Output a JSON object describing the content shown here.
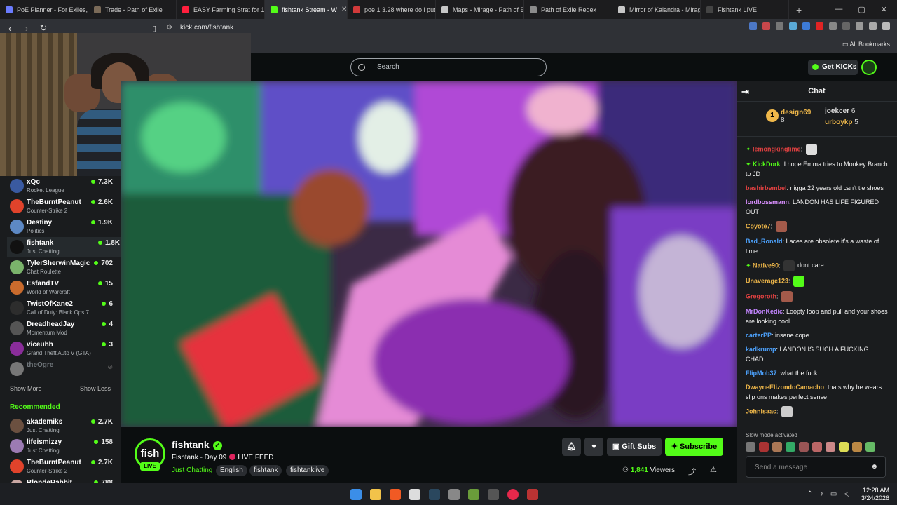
{
  "browser": {
    "tabs": [
      {
        "title": "PoE Planner - For Exiles, By",
        "color": "#6b7cff"
      },
      {
        "title": "Trade - Path of Exile",
        "color": "#7a6a58"
      },
      {
        "title": "EASY Farming Strat for 15-",
        "color": "#ff1f3d"
      },
      {
        "title": "fishtank Stream - W",
        "color": "#53fc18",
        "active": true
      },
      {
        "title": "poe 1 3.28 where do i put",
        "color": "#d23a3a"
      },
      {
        "title": "Maps - Mirage - Path of E",
        "color": "#c7c7c7"
      },
      {
        "title": "Path of Exile Regex",
        "color": "#8b8b8b"
      },
      {
        "title": "Mirror of Kalandra - Mirag",
        "color": "#c7c7c7"
      },
      {
        "title": "Fishtank LIVE",
        "color": "#444"
      }
    ],
    "url": "kick.com/fishtank",
    "all_bookmarks": "All Bookmarks"
  },
  "header": {
    "search_placeholder": "Search",
    "get_kicks": "Get KICKs"
  },
  "sidebar": {
    "following": [
      {
        "name": "xQc",
        "category": "Rocket League",
        "viewers": "7.3K",
        "color": "#3a5aa0"
      },
      {
        "name": "TheBurntPeanut",
        "category": "Counter-Strike 2",
        "viewers": "2.6K",
        "color": "#e0432b"
      },
      {
        "name": "Destiny",
        "category": "Politics",
        "viewers": "1.9K",
        "color": "#5d89c4"
      },
      {
        "name": "fishtank",
        "category": "Just Chatting",
        "viewers": "1.8K",
        "color": "#111",
        "selected": true
      },
      {
        "name": "TylerSherwinMagic",
        "category": "Chat Roulette",
        "viewers": "702",
        "color": "#7ab36b"
      },
      {
        "name": "EsfandTV",
        "category": "World of Warcraft",
        "viewers": "15",
        "color": "#c96b2d"
      },
      {
        "name": "TwistOfKane2",
        "category": "Call of Duty: Black Ops 7",
        "viewers": "6",
        "color": "#2d2d2d"
      },
      {
        "name": "DreadheadJay",
        "category": "Momentum Mod",
        "viewers": "4",
        "color": "#555"
      },
      {
        "name": "viceuhh",
        "category": "Grand Theft Auto V (GTA)",
        "viewers": "3",
        "color": "#8a2d9a"
      },
      {
        "name": "theOgre",
        "category": "",
        "viewers": "",
        "color": "#777",
        "offline": true
      }
    ],
    "show_more": "Show More",
    "show_less": "Show Less",
    "recommended_label": "Recommended",
    "recommended": [
      {
        "name": "akademiks",
        "category": "Just Chatting",
        "viewers": "2.7K",
        "color": "#6b5040"
      },
      {
        "name": "lifeismizzy",
        "category": "Just Chatting",
        "viewers": "158",
        "color": "#9c7bb3"
      },
      {
        "name": "TheBurntPeanut",
        "category": "Counter-Strike 2",
        "viewers": "2.7K",
        "color": "#e0432b"
      },
      {
        "name": "BlondeRabbit",
        "category": "",
        "viewers": "788",
        "color": "#c9a7a2"
      }
    ]
  },
  "stream": {
    "channel": "fishtank",
    "logo_text": "fish",
    "live_badge": "LIVE",
    "title": "Fishtank - Day 09",
    "live_feed": "LIVE FEED",
    "category": "Just Chatting",
    "tags": [
      "English",
      "fishtank",
      "fishtanklive"
    ],
    "gift_subs": "Gift Subs",
    "subscribe": "Subscribe",
    "viewers_count": "1,841",
    "viewers_label": "Viewers"
  },
  "chat": {
    "title": "Chat",
    "leaderboard": [
      {
        "rank": "1",
        "name": "design69",
        "count": "8"
      },
      {
        "name": "joekcer",
        "count": "6"
      },
      {
        "name": "urboykp",
        "count": "5"
      }
    ],
    "messages": [
      {
        "user": "lemongkinglime",
        "text": "",
        "color": "#e34141",
        "emote": "#ddd",
        "badge": true
      },
      {
        "user": "KickDork",
        "text": "I hope Emma tries to Monkey Branch to JD",
        "color": "#53fc18",
        "badge": true
      },
      {
        "user": "bashirbembel",
        "text": "nigga 22 years old can't tie shoes",
        "color": "#e34141"
      },
      {
        "user": "lordbossmann",
        "text": "LANDON HAS LIFE FIGURED OUT",
        "color": "#d98fff"
      },
      {
        "user": "Coyote7",
        "text": "",
        "color": "#f0b84a",
        "emote": "#a35a4a"
      },
      {
        "user": "Bad_Ronald",
        "text": "Laces are obsolete it's a waste of time",
        "color": "#4da3ff"
      },
      {
        "user": "Native90",
        "text": "dont care",
        "color": "#f0b84a",
        "emote": "#333",
        "badge": true
      },
      {
        "user": "Unaverage123",
        "text": "",
        "color": "#f0b84a",
        "emote": "#53fc18"
      },
      {
        "user": "Gregoroth",
        "text": "",
        "color": "#e34141",
        "emote": "#a35a4a"
      },
      {
        "user": "MrDonKedic",
        "text": "Loopty loop and pull and your shoes are looking cool",
        "color": "#c084fc"
      },
      {
        "user": "carterPP",
        "text": "insane cope",
        "color": "#4da3ff"
      },
      {
        "user": "karlkrump",
        "text": "LANDON IS SUCH A FUCKING CHAD",
        "color": "#4da3ff"
      },
      {
        "user": "FlipMob37",
        "text": "what the fuck",
        "color": "#4da3ff"
      },
      {
        "user": "DwayneElizondoCamacho",
        "text": "thats why he wears slip ons makes perfect sense",
        "color": "#f0b84a"
      },
      {
        "user": "JohnIsaac",
        "text": "",
        "color": "#f0b84a",
        "emote": "#ccc"
      }
    ],
    "slow_mode": "Slow mode activated",
    "send_placeholder": "Send a message"
  },
  "taskbar": {
    "time": "12:28 AM",
    "date": "3/24/2026"
  }
}
